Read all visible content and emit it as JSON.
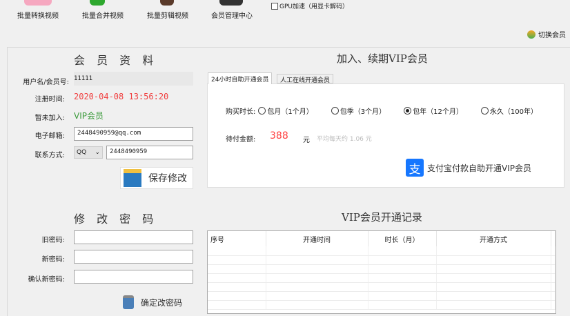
{
  "toolbar": {
    "items": [
      {
        "label": "批量转换视频",
        "icon": "convert-icon"
      },
      {
        "label": "批量合并视频",
        "icon": "merge-icon"
      },
      {
        "label": "批量剪辑视频",
        "icon": "clip-icon"
      },
      {
        "label": "会员管理中心",
        "icon": "member-center-icon"
      }
    ],
    "gpu_label": "GPU加速（用显卡解码）",
    "gpu_checked": false,
    "switch_member": "切换会员"
  },
  "profile": {
    "title": "会 员 资 料",
    "username_label": "用户名/会员号:",
    "username": "11111",
    "reg_label": "注册时间:",
    "reg_time": "2020-04-08 13:56:20",
    "status_label": "暂未加入:",
    "status": "VIP会员",
    "email_label": "电子邮箱:",
    "email": "2448490959@qq.com",
    "contact_label": "联系方式:",
    "contact_type": "QQ",
    "contact": "2448490959",
    "save": "保存修改"
  },
  "password": {
    "title": "修 改 密 码",
    "old_label": "旧密码:",
    "new_label": "新密码:",
    "confirm_label": "确认新密码:",
    "old": "",
    "new": "",
    "confirm": "",
    "submit": "确定改密码"
  },
  "vip": {
    "title": "加入、续期VIP会员",
    "tabs": [
      "24小时自助开通会员",
      "人工在线开通会员"
    ],
    "active_tab": 0,
    "duration_label": "购买时长:",
    "options": [
      {
        "label": "包月（1个月）",
        "selected": false
      },
      {
        "label": "包季（3个月）",
        "selected": false
      },
      {
        "label": "包年（12个月）",
        "selected": true
      },
      {
        "label": "永久（100年）",
        "selected": false
      }
    ],
    "amount_label": "待付金额:",
    "amount": "388",
    "unit": "元",
    "daily": "平均每天约 1.06 元",
    "alipay": "支付宝付款自助开通VIP会员",
    "alipay_color": "#1677ff",
    "amount_color": "#ff4040"
  },
  "records": {
    "title": "VIP会员开通记录",
    "columns": [
      "序号",
      "开通时间",
      "时长（月）",
      "开通方式"
    ],
    "rows": []
  }
}
